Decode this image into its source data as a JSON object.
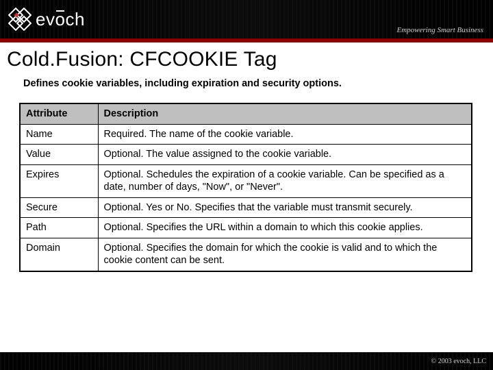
{
  "header": {
    "brand": "evōch",
    "tagline": "Empowering Smart Business"
  },
  "title": "Cold.Fusion: CFCOOKIE Tag",
  "subtitle": "Defines cookie variables, including expiration and security options.",
  "table": {
    "headers": [
      "Attribute",
      "Description"
    ],
    "rows": [
      {
        "attr": "Name",
        "desc": "Required. The name of the cookie variable."
      },
      {
        "attr": "Value",
        "desc": "Optional. The value assigned to the cookie variable."
      },
      {
        "attr": "Expires",
        "desc": "Optional. Schedules the expiration of a cookie variable. Can be specified as a date, number of days, \"Now\", or \"Never\"."
      },
      {
        "attr": "Secure",
        "desc": "Optional. Yes or No. Specifies that the variable must transmit securely."
      },
      {
        "attr": "Path",
        "desc": "Optional. Specifies the URL within a domain to which this cookie applies."
      },
      {
        "attr": "Domain",
        "desc": "Optional. Specifies the domain for which the cookie is valid and to which the cookie content can be sent."
      }
    ]
  },
  "footer": {
    "copyright": "© 2003 evoch, LLC"
  }
}
